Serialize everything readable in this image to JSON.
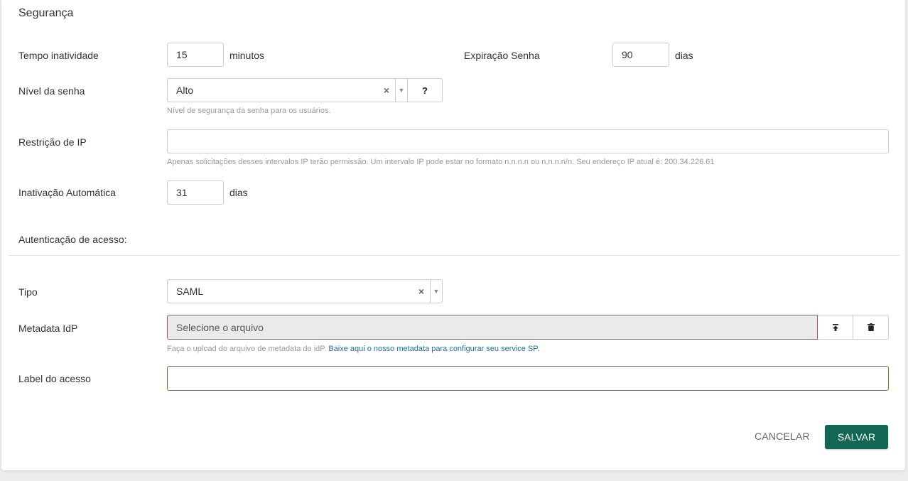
{
  "section_title": "Segurança",
  "inactivity": {
    "label": "Tempo inatividade",
    "value": "15",
    "unit": "minutos"
  },
  "password_expiry": {
    "label": "Expiração Senha",
    "value": "90",
    "unit": "dias"
  },
  "password_level": {
    "label": "Nível da senha",
    "value": "Alto",
    "clear": "×",
    "caret": "▼",
    "help_button": "?",
    "help": "Nível de segurança da senha para os usuários."
  },
  "ip_restriction": {
    "label": "Restrição de IP",
    "value": "",
    "help": "Apenas solicitações desses intervalos IP terão permissão. Um intervalo IP pode estar no formato n.n.n.n ou n.n.n.n/n. Seu endereço IP atual é: 200.34.226.61"
  },
  "auto_inactivation": {
    "label": "Inativação Automática",
    "value": "31",
    "unit": "dias"
  },
  "access_auth_heading": "Autenticação de acesso:",
  "type": {
    "label": "Tipo",
    "value": "SAML",
    "clear": "×",
    "caret": "▼"
  },
  "metadata": {
    "label": "Metadata IdP",
    "placeholder": "Selecione o arquivo",
    "help_prefix": "Faça o upload do arquivo de metadata do idP.",
    "help_link": "Baixe aqui o nosso metadata para configurar seu service SP."
  },
  "access_label": {
    "label": "Label do acesso",
    "value": ""
  },
  "actions": {
    "cancel": "CANCELAR",
    "save": "SALVAR"
  },
  "colors": {
    "primary": "#136654",
    "link": "#1f6f9f",
    "error_border": "#a75a4a",
    "label_border": "#8a6a2a"
  }
}
